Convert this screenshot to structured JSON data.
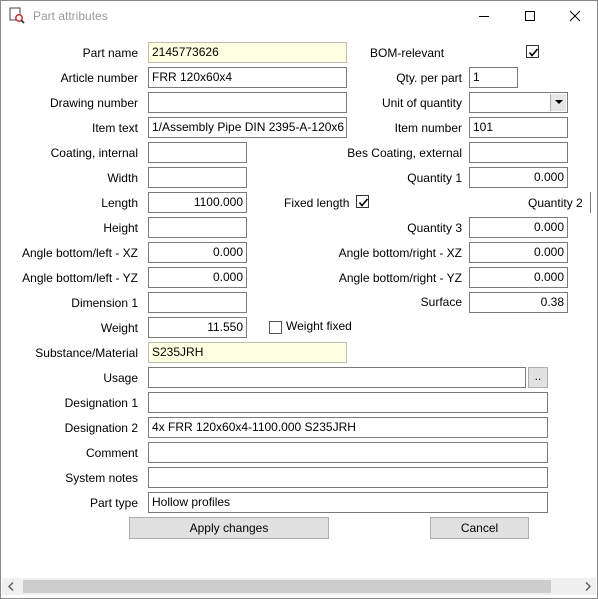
{
  "window": {
    "title": "Part attributes"
  },
  "labels": {
    "part_name": "Part name",
    "article_number": "Article number",
    "drawing_number": "Drawing number",
    "item_text": "Item text",
    "coating_internal": "Coating, internal",
    "width": "Width",
    "length": "Length",
    "height": "Height",
    "angle_bl_xz": "Angle bottom/left - XZ",
    "angle_bl_yz": "Angle bottom/left - YZ",
    "dimension_1": "Dimension 1",
    "weight": "Weight",
    "substance": "Substance/Material",
    "usage": "Usage",
    "designation_1": "Designation 1",
    "designation_2": "Designation 2",
    "comment": "Comment",
    "system_notes": "System notes",
    "part_type": "Part type",
    "bom_relevant": "BOM-relevant",
    "qty_per_part": "Qty. per part",
    "unit_of_quantity": "Unit of quantity",
    "item_number": "Item number",
    "coating_external": "Bes Coating, external",
    "quantity_1": "Quantity 1",
    "fixed_length": "Fixed length",
    "quantity_2": "Quantity 2",
    "quantity_3": "Quantity 3",
    "angle_br_xz": "Angle bottom/right - XZ",
    "angle_br_yz": "Angle bottom/right - YZ",
    "surface": "Surface",
    "weight_fixed": "Weight fixed"
  },
  "values": {
    "part_name": "2145773626",
    "article_number": "FRR 120x60x4",
    "drawing_number": "",
    "item_text": "1/Assembly Pipe DIN 2395-A-120x6",
    "coating_internal": "",
    "width": "",
    "length": "1100.000",
    "height": "",
    "angle_bl_xz": "0.000",
    "angle_bl_yz": "0.000",
    "dimension_1": "",
    "weight": "11.550",
    "substance": "S235JRH",
    "usage": "",
    "designation_1": "",
    "designation_2": "4x FRR 120x60x4-1100.000 S235JRH",
    "comment": "",
    "system_notes": "",
    "part_type": "Hollow profiles",
    "qty_per_part": "1",
    "unit_of_quantity": "",
    "item_number": "101",
    "coating_external": "",
    "quantity_1": "0.000",
    "quantity_3": "0.000",
    "angle_br_xz": "0.000",
    "angle_br_yz": "0.000",
    "surface": "0.38"
  },
  "checks": {
    "bom_relevant": true,
    "fixed_length": true,
    "weight_fixed": false
  },
  "buttons": {
    "apply": "Apply changes",
    "cancel": "Cancel",
    "browse": ".."
  },
  "colors": {
    "highlight_field": "#ffffe1",
    "title_text": "#9a9a9a"
  }
}
